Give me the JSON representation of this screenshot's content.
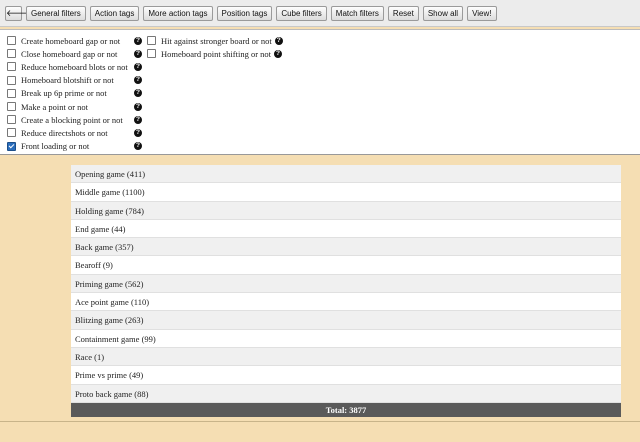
{
  "toolbar": {
    "back_glyph": "🡐",
    "buttons": [
      "General filters",
      "Action tags",
      "More action tags",
      "Position tags",
      "Cube filters",
      "Match filters",
      "Reset",
      "Show all",
      "View!"
    ]
  },
  "filters": {
    "help_glyph": "?",
    "left": [
      {
        "label": "Create homeboard gap or not",
        "checked": false
      },
      {
        "label": "Close homeboard gap or not",
        "checked": false
      },
      {
        "label": "Reduce homeboard blots or not",
        "checked": false
      },
      {
        "label": "Homeboard blotshift or not",
        "checked": false
      },
      {
        "label": "Break up 6p prime or not",
        "checked": false
      },
      {
        "label": "Make a point or not",
        "checked": false
      },
      {
        "label": "Create a blocking point or not",
        "checked": false
      },
      {
        "label": "Reduce directshots or not",
        "checked": false
      },
      {
        "label": "Front loading or not",
        "checked": true
      }
    ],
    "right": [
      {
        "label": "Hit against stronger board or not",
        "checked": false
      },
      {
        "label": "Homeboard point shifting or not",
        "checked": false
      }
    ]
  },
  "table": {
    "rows": [
      "Opening game (411)",
      "Middle game (1100)",
      "Holding game (784)",
      "End game (44)",
      "Back game (357)",
      "Bearoff (9)",
      "Priming game (562)",
      "Ace point game (110)",
      "Blitzing game (263)",
      "Containment game (99)",
      "Race (1)",
      "Prime vs prime (49)",
      "Proto back game (88)"
    ],
    "total": "Total: 3877"
  },
  "colors": {
    "background": "#f5deb3",
    "check_accent": "#2a6ebd",
    "total_bar": "#5a5a5a"
  }
}
